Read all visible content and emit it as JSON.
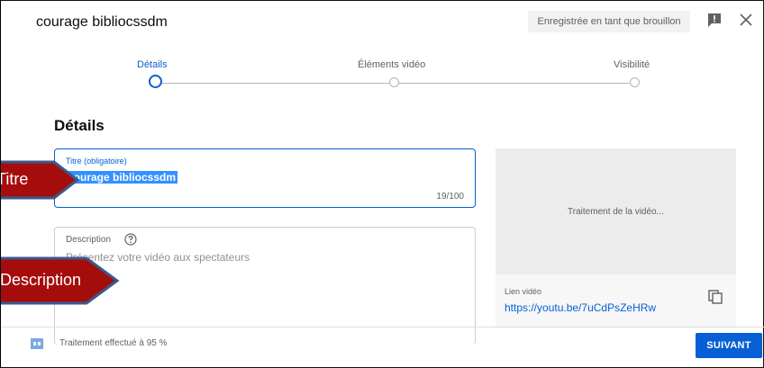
{
  "header": {
    "title": "courage bibliocssdm",
    "draft_badge": "Enregistrée en tant que brouillon"
  },
  "stepper": {
    "steps": [
      {
        "label": "Détails",
        "active": true
      },
      {
        "label": "Éléments vidéo",
        "active": false
      },
      {
        "label": "Visibilité",
        "active": false
      }
    ]
  },
  "details": {
    "heading": "Détails",
    "title_field": {
      "label": "Titre (obligatoire)",
      "value": "courage bibliocssdm",
      "counter": "19/100"
    },
    "description_field": {
      "label": "Description",
      "placeholder": "Présentez votre vidéo aux spectateurs"
    }
  },
  "preview": {
    "status": "Traitement de la vidéo...",
    "link_label": "Lien vidéo",
    "link_url": "https://youtu.be/7uCdPsZeHRw"
  },
  "footer": {
    "status": "Traitement effectué à 95 %",
    "next_label": "SUIVANT"
  },
  "annotations": {
    "titre": "Titre",
    "description": "Description"
  },
  "colors": {
    "accent": "#065fd4",
    "callout_fill": "#a50d0d",
    "callout_border": "#3a5a8c"
  }
}
